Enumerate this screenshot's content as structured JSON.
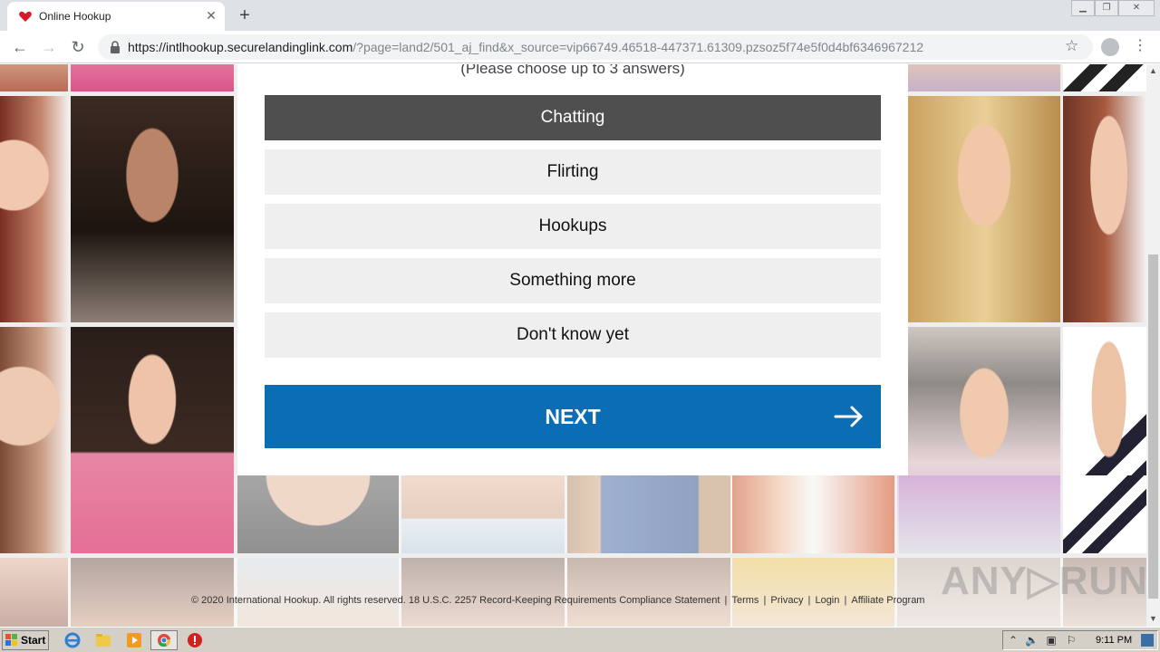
{
  "browser": {
    "tab_title": "Online Hookup",
    "url_host": "https://intlhookup.securelandinglink.com",
    "url_rest": "/?page=land2/501_aj_find&x_source=vip66749.46518-447371.61309.pzsoz5f74e5f0d4bf6346967212",
    "new_tab": "+",
    "tab_close": "✕"
  },
  "quiz": {
    "hint": "(Please choose up to 3 answers)",
    "options": [
      {
        "label": "Chatting",
        "selected": true
      },
      {
        "label": "Flirting",
        "selected": false
      },
      {
        "label": "Hookups",
        "selected": false
      },
      {
        "label": "Something more",
        "selected": false
      },
      {
        "label": "Don't know yet",
        "selected": false
      }
    ],
    "next_label": "NEXT",
    "accent_color": "#0b6db4",
    "selected_color": "#4f4f4f"
  },
  "footer": {
    "copyright": "© 2020 International Hookup. All rights reserved. 18 U.S.C. 2257 Record-Keeping Requirements Compliance Statement",
    "terms": "Terms",
    "privacy": "Privacy",
    "login": "Login",
    "affiliate": "Affiliate Program",
    "sep": "|"
  },
  "watermark": "ANY▷RUN",
  "taskbar": {
    "start_label": "Start",
    "clock": "9:11 PM"
  }
}
